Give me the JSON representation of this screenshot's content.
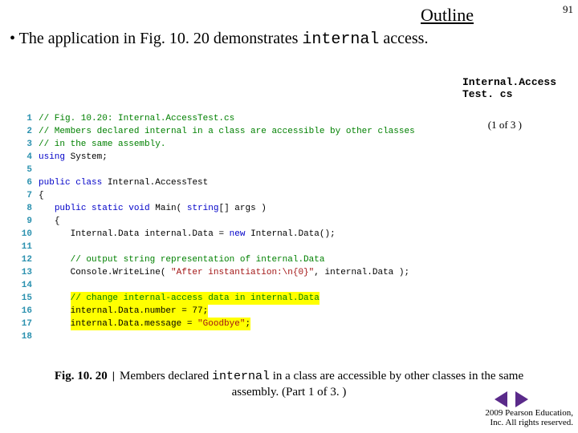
{
  "header": {
    "outline": "Outline",
    "page_no": "91"
  },
  "bullet": {
    "dot": "•",
    "text_a": "The application in Fig. 10. 20 demonstrates ",
    "text_kw": "internal",
    "text_b": " access."
  },
  "file": {
    "line1": "Internal.Access",
    "line2": "Test. cs"
  },
  "part": "(1 of 3 )",
  "code": [
    {
      "n": "1",
      "html": "<span class='c-comment'>// Fig. 10.20: Internal.AccessTest.cs</span>"
    },
    {
      "n": "2",
      "html": "<span class='c-comment'>// Members declared internal in a class are accessible by other classes</span>"
    },
    {
      "n": "3",
      "html": "<span class='c-comment'>// in the same assembly.</span>"
    },
    {
      "n": "4",
      "html": "<span class='c-key'>using</span> <span class='c-plain'>System;</span>"
    },
    {
      "n": "5",
      "html": ""
    },
    {
      "n": "6",
      "html": "<span class='c-key'>public class</span> <span class='c-plain'>Internal.AccessTest</span>"
    },
    {
      "n": "7",
      "html": "<span class='c-plain'>{</span>"
    },
    {
      "n": "8",
      "html": "   <span class='c-key'>public static void</span> <span class='c-plain'>Main(</span> <span class='c-key'>string</span><span class='c-plain'>[] args )</span>"
    },
    {
      "n": "9",
      "html": "   <span class='c-plain'>{</span>"
    },
    {
      "n": "10",
      "html": "      <span class='c-plain'>Internal.Data internal.Data = </span><span class='c-key'>new</span><span class='c-plain'> Internal.Data();</span>"
    },
    {
      "n": "11",
      "html": ""
    },
    {
      "n": "12",
      "html": "      <span class='c-comment'>// output string representation of internal.Data</span>"
    },
    {
      "n": "13",
      "html": "      <span class='c-plain'>Console.WriteLine( </span><span class='c-str'>\"After instantiation:\\n{0}\"</span><span class='c-plain'>, internal.Data );</span>"
    },
    {
      "n": "14",
      "html": ""
    },
    {
      "n": "15",
      "html": "      <span class='hl'><span class='c-comment'>// change internal-access data in internal.Data</span></span>"
    },
    {
      "n": "16",
      "html": "      <span class='hl'><span class='c-plain'>internal.Data.number = 77;</span></span>"
    },
    {
      "n": "17",
      "html": "      <span class='hl'><span class='c-plain'>internal.Data.message = </span><span class='c-str'>\"Goodbye\"</span><span class='c-plain'>;</span></span>"
    },
    {
      "n": "18",
      "html": ""
    }
  ],
  "caption": {
    "figno": "Fig. 10. 20 ",
    "pipe": "|",
    "body_a": " Members declared ",
    "body_kw": "internal",
    "body_b": " in a class are accessible by other classes in the same assembly. (Part 1 of 3. )"
  },
  "footer": {
    "l1": "  2009 Pearson Education,",
    "l2": "Inc.  All rights reserved."
  },
  "icons": {
    "prev": "prev-icon",
    "next": "next-icon"
  }
}
